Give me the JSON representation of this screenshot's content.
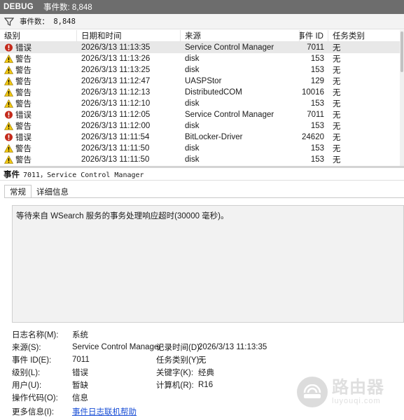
{
  "titlebar": {
    "name": "DEBUG",
    "event_count": "事件数: 8,848"
  },
  "filterbar": {
    "icon": "funnel-icon",
    "label": "事件数： 8,848"
  },
  "grid": {
    "columns": [
      "级别",
      "日期和时间",
      "来源",
      "事件 ID",
      "任务类别"
    ],
    "rows": [
      {
        "level": "错误",
        "icon": "error-icon",
        "date": "2026/3/13 11:13:35",
        "source": "Service Control Manager",
        "id": "7011",
        "task": "无"
      },
      {
        "level": "警告",
        "icon": "warning-icon",
        "date": "2026/3/13 11:13:26",
        "source": "disk",
        "id": "153",
        "task": "无"
      },
      {
        "level": "警告",
        "icon": "warning-icon",
        "date": "2026/3/13 11:13:25",
        "source": "disk",
        "id": "153",
        "task": "无"
      },
      {
        "level": "警告",
        "icon": "warning-icon",
        "date": "2026/3/13 11:12:47",
        "source": "UASPStor",
        "id": "129",
        "task": "无"
      },
      {
        "level": "警告",
        "icon": "warning-icon",
        "date": "2026/3/13 11:12:13",
        "source": "DistributedCOM",
        "id": "10016",
        "task": "无"
      },
      {
        "level": "警告",
        "icon": "warning-icon",
        "date": "2026/3/13 11:12:10",
        "source": "disk",
        "id": "153",
        "task": "无"
      },
      {
        "level": "错误",
        "icon": "error-icon",
        "date": "2026/3/13 11:12:05",
        "source": "Service Control Manager",
        "id": "7011",
        "task": "无"
      },
      {
        "level": "警告",
        "icon": "warning-icon",
        "date": "2026/3/13 11:12:00",
        "source": "disk",
        "id": "153",
        "task": "无"
      },
      {
        "level": "错误",
        "icon": "error-icon",
        "date": "2026/3/13 11:11:54",
        "source": "BitLocker-Driver",
        "id": "24620",
        "task": "无"
      },
      {
        "level": "警告",
        "icon": "warning-icon",
        "date": "2026/3/13 11:11:50",
        "source": "disk",
        "id": "153",
        "task": "无"
      },
      {
        "level": "警告",
        "icon": "warning-icon",
        "date": "2026/3/13 11:11:50",
        "source": "disk",
        "id": "153",
        "task": "无"
      }
    ]
  },
  "detail": {
    "header_label": "事件",
    "header_text": "7011，Service Control Manager",
    "tabs": [
      "常规",
      "详细信息"
    ],
    "description": "等待来自 WSearch 服务的事务处理响应超时(30000 毫秒)。",
    "props": {
      "log_name_label": "日志名称(M):",
      "log_name": "系统",
      "source_label": "来源(S):",
      "source": "Service Control Manager",
      "logged_label": "记录时间(D):",
      "logged": "2026/3/13 11:13:35",
      "event_id_label": "事件 ID(E):",
      "event_id": "7011",
      "task_label": "任务类别(Y):",
      "task": "无",
      "level_label": "级别(L):",
      "level": "错误",
      "keywords_label": "关键字(K):",
      "keywords": "经典",
      "user_label": "用户(U):",
      "user": "暂缺",
      "computer_label": "计算机(R):",
      "computer": "R16",
      "opcode_label": "操作代码(O):",
      "opcode": "信息",
      "more_label": "更多信息(I):",
      "more_link": "事件日志联机帮助"
    }
  },
  "watermark": {
    "big": "路由器",
    "small": "luyouqi.com"
  },
  "colors": {
    "titlebar": "#6d6d6d",
    "error": "#c42b1c",
    "warning": "#f2c811",
    "link": "#1a4fd6"
  }
}
